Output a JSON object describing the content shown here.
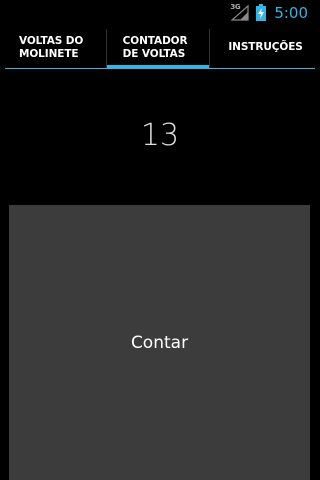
{
  "status_bar": {
    "network_type": "3G",
    "time": "5:00",
    "icons": [
      "signal-icon",
      "battery-charging-icon"
    ]
  },
  "tabs": [
    {
      "label_line1": "VOLTAS DO",
      "label_line2": "MOLINETE",
      "selected": false
    },
    {
      "label_line1": "CONTADOR",
      "label_line2": "DE VOLTAS",
      "selected": true
    },
    {
      "label_line1": "INSTRUÇÕES",
      "label_line2": "",
      "selected": false
    }
  ],
  "counter": {
    "value": "13"
  },
  "count_button": {
    "label": "Contar"
  },
  "colors": {
    "accent": "#33b5e5",
    "background": "#000000",
    "button": "#3c3c3c"
  }
}
